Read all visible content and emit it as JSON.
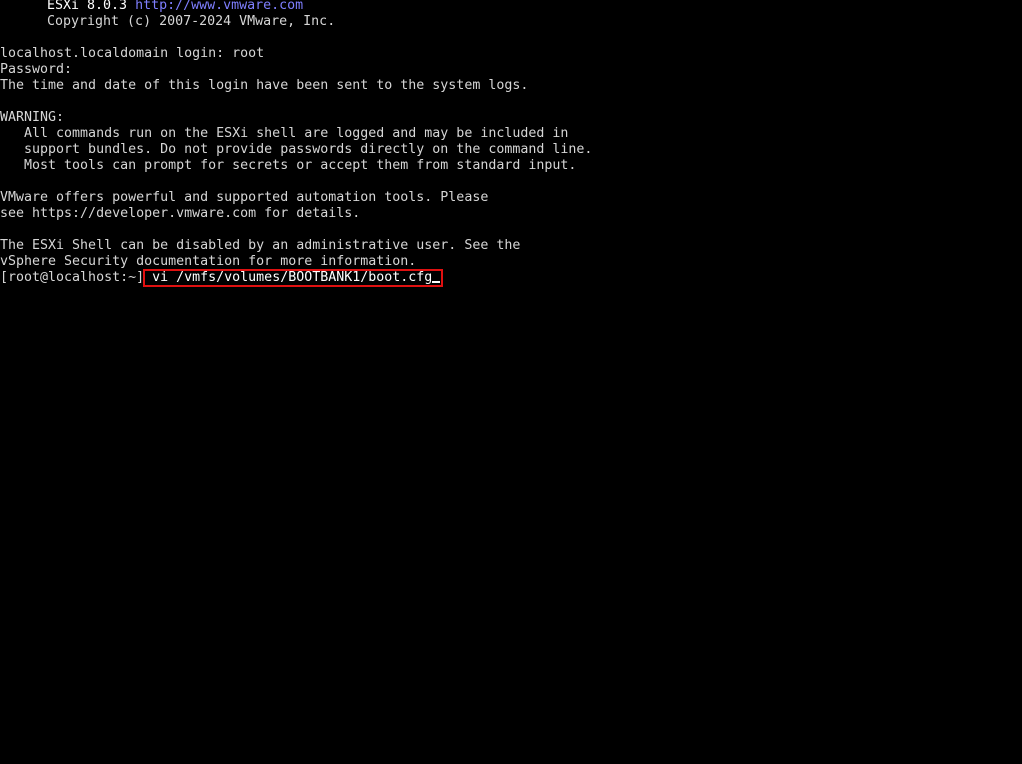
{
  "console": {
    "banner": {
      "product": "ESXi 8.0.3",
      "url": "http://www.vmware.com",
      "copyright": "Copyright (c) 2007-2024 VMware, Inc."
    },
    "login_line": "localhost.localdomain login: root",
    "password_line": "Password:",
    "logged_notice": "The time and date of this login have been sent to the system logs.",
    "warning_title": "WARNING:",
    "warning_lines": [
      "   All commands run on the ESXi shell are logged and may be included in",
      "   support bundles. Do not provide passwords directly on the command line.",
      "   Most tools can prompt for secrets or accept them from standard input."
    ],
    "automation_lines": [
      "VMware offers powerful and supported automation tools. Please",
      "see https://developer.vmware.com for details."
    ],
    "shell_lines": [
      "The ESXi Shell can be disabled by an administrative user. See the",
      "vSphere Security documentation for more information."
    ],
    "prompt": "[root@localhost:~] ",
    "command": "vi /vmfs/volumes/BOOTBANK1/boot.cfg"
  },
  "colors": {
    "background": "#000000",
    "text": "#d6d6d6",
    "link": "#7f7fff",
    "highlight_box": "#e01010"
  }
}
